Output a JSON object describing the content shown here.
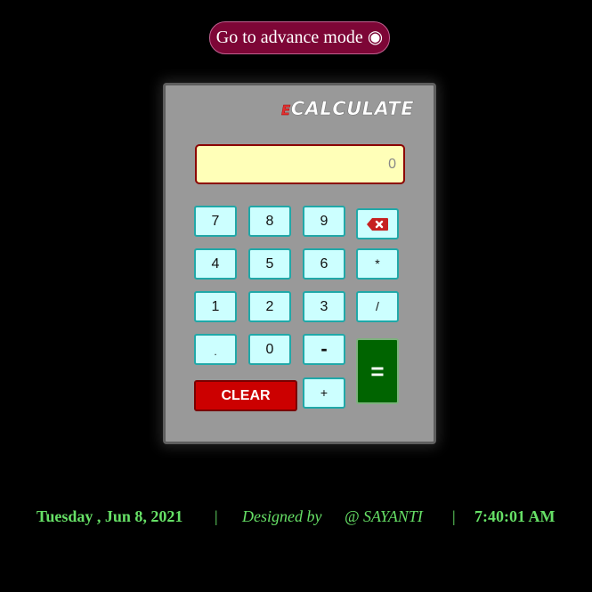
{
  "advance_button": {
    "label": "Go to advance mode ◉"
  },
  "calculator": {
    "logo_prefix": "E",
    "logo_text": "CALCULATE",
    "display_value": "0",
    "keys": {
      "k7": "7",
      "k8": "8",
      "k9": "9",
      "k4": "4",
      "k5": "5",
      "k6": "6",
      "k1": "1",
      "k2": "2",
      "k3": "3",
      "dot": ".",
      "k0": "0",
      "minus": "-",
      "multiply": "*",
      "divide": "/",
      "plus": "+",
      "equals": "=",
      "clear": "CLEAR"
    },
    "backspace_icon": "backspace-icon",
    "colors": {
      "key_bg": "#ccffff",
      "key_border": "#20a8a8",
      "display_bg": "#ffffb8",
      "equals_bg": "#006400",
      "clear_bg": "#cc0000",
      "advance_bg": "#7d0636",
      "footer_text": "#66e066"
    }
  },
  "footer": {
    "date": "Tuesday , Jun 8, 2021",
    "separator_1": "|",
    "designed_by": "Designed by",
    "author": "@ SAYANTI",
    "separator_2": "|",
    "time": "7:40:01 AM"
  }
}
